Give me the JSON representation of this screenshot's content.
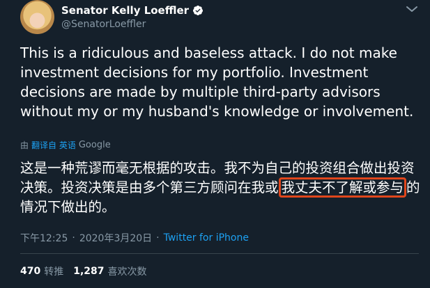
{
  "author": {
    "display_name": "Senator Kelly Loeffler",
    "handle": "@SenatorLoeffler",
    "verified": true,
    "verified_icon": "verified-badge-icon"
  },
  "tweet": {
    "text": "This is a ridiculous and baseless attack. I do not make investment decisions for my portfolio. Investment decisions are made by multiple third-party advisors without my or my husband's knowledge or involvement."
  },
  "translation": {
    "prefix": "由",
    "link_label": "翻译自 英语",
    "provider": "Google",
    "text_before": "这是一种荒谬而毫无根据的攻击。我不为自己的投资组合做出投资决策。投资决策是由多个第三方顾问在我或",
    "text_highlighted": "我丈夫不了解或参与",
    "text_after": "的情况下做出的。"
  },
  "meta": {
    "time": "下午12:25",
    "separator1": "·",
    "date": "2020年3月20日",
    "separator2": "·",
    "source": "Twitter for iPhone"
  },
  "stats": {
    "retweets_count": "470",
    "retweets_label": "转推",
    "likes_count": "1,287",
    "likes_label": "喜欢次数"
  },
  "colors": {
    "background": "#15202b",
    "link": "#1da1f2",
    "muted": "#8899a6",
    "highlight_border": "#e0461c"
  }
}
